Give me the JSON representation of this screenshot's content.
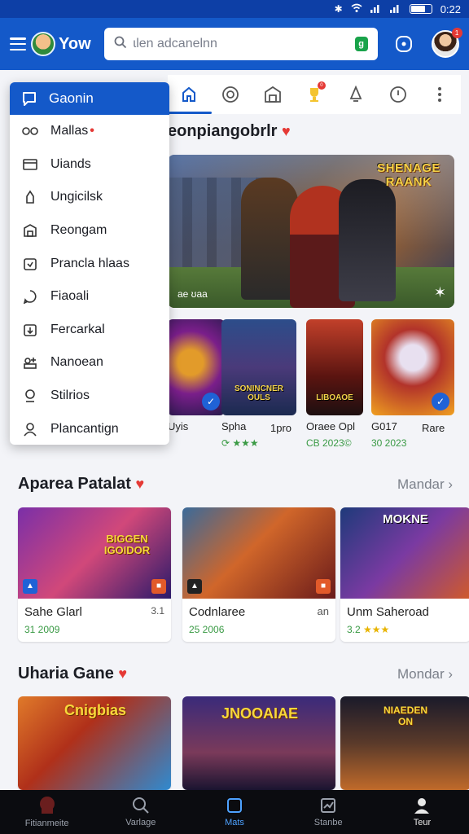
{
  "status": {
    "time": "0:22"
  },
  "app": {
    "title": "Yow"
  },
  "search": {
    "placeholder": "ɩlen adcanelnn",
    "mic_label": "g"
  },
  "profile": {
    "badge": "1"
  },
  "tabs": [
    {
      "icon": "home-icon",
      "active": true
    },
    {
      "icon": "target-icon",
      "active": false
    },
    {
      "icon": "store-icon",
      "active": false
    },
    {
      "icon": "trophy-icon",
      "active": false,
      "badge": "0"
    },
    {
      "icon": "bell-icon",
      "active": false
    },
    {
      "icon": "clock-icon",
      "active": false
    },
    {
      "icon": "more-icon",
      "active": false
    }
  ],
  "drawer": {
    "header": "Gaonin",
    "items": [
      {
        "label": "Mallas",
        "icon": "gamepad-icon",
        "dot": "•"
      },
      {
        "label": "Uiands",
        "icon": "folder-icon"
      },
      {
        "label": "Ungicilsk",
        "icon": "user-icon"
      },
      {
        "label": "Reongam",
        "icon": "store-icon"
      },
      {
        "label": "Prancla hlaas",
        "icon": "calendar-icon"
      },
      {
        "label": "Fiaoali",
        "icon": "chat-icon"
      },
      {
        "label": "Fercarkal",
        "icon": "download-icon"
      },
      {
        "label": "Nanoean",
        "icon": "group-icon"
      },
      {
        "label": "Stilrios",
        "icon": "trophy-icon"
      },
      {
        "label": "Plancantign",
        "icon": "user-icon"
      }
    ]
  },
  "featured": {
    "title": "eonpiangobrlr",
    "hero_logo": "SHENAGE\nRAANK",
    "hero_caption": "ae ʊaa",
    "thumbs": [
      {
        "name": "Uyis",
        "meta": "",
        "art_title": "",
        "has_download": true
      },
      {
        "name": "Spha",
        "meta": "⟳ ★★★",
        "art_title": "SONINCNER\nOULS",
        "has_download": false
      },
      {
        "name": "1pro",
        "meta": "",
        "art_title": "",
        "has_download": false
      },
      {
        "name": "Oraee Opl",
        "meta": "CB 2023©",
        "art_title": "LIBOAOE",
        "has_download": false
      },
      {
        "name": "G017",
        "meta": "30 2023",
        "art_title": "",
        "has_download": true
      },
      {
        "name": "Rare",
        "meta": "",
        "art_title": "",
        "has_download": false
      }
    ]
  },
  "section2": {
    "title": "Aparea Patalat",
    "more": "Mandar",
    "cards": [
      {
        "title": "Sahe Glarl",
        "extra": "3.1",
        "meta_num": "31 2009",
        "stars": "",
        "art_title": "BIGGEN\nIGOIDOR"
      },
      {
        "title": "Codnlaree",
        "extra": "an",
        "meta_num": "25 2006",
        "stars": "",
        "art_title": ""
      },
      {
        "title": "Unm Saheroad",
        "extra": "",
        "meta_num": "3.2",
        "stars": "★★★",
        "art_title": "MOKNE"
      }
    ]
  },
  "section3": {
    "title": "Uharia Gane",
    "more": "Mondar",
    "cards": [
      {
        "art_title": "Cnigbias"
      },
      {
        "art_title": "JNOOAIAE"
      },
      {
        "art_title": "NIAEDEN\nON"
      }
    ]
  },
  "bottom_nav": [
    {
      "label": "Fitianmeite",
      "icon": "home-icon",
      "active": false
    },
    {
      "label": "Varlage",
      "icon": "search-icon",
      "active": false
    },
    {
      "label": "Mats",
      "icon": "square-icon",
      "active": true
    },
    {
      "label": "Stanbe",
      "icon": "chart-icon",
      "active": false
    },
    {
      "label": "Teur",
      "icon": "profile-icon",
      "active": false
    }
  ],
  "colors": {
    "brand": "#1459c9",
    "accent_red": "#e53935",
    "rating_green": "#3a9a45"
  }
}
